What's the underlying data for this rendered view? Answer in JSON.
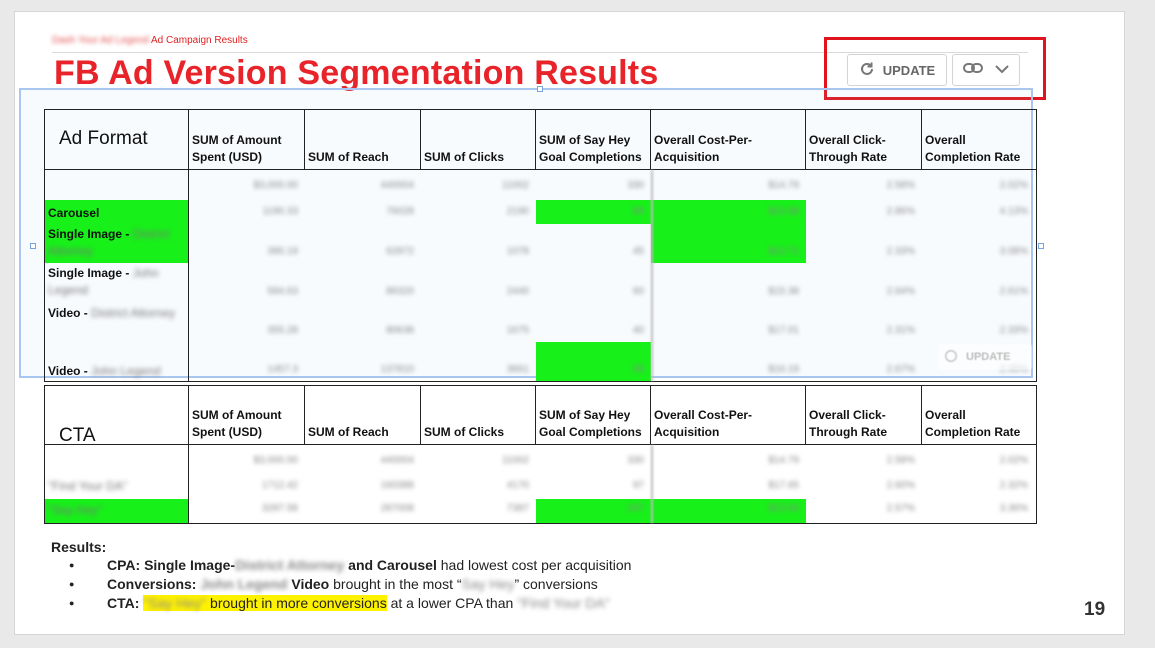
{
  "breadcrumb": {
    "blurred": "Dash Your Ad Legend",
    "label": "Ad Campaign Results"
  },
  "title": "FB Ad Version Segmentation Results",
  "toolbar": {
    "update_label": "UPDATE",
    "ghost_update_label": "UPDATE"
  },
  "columns": [
    "SUM of Amount Spent (USD)",
    "SUM of Reach",
    "SUM of Clicks",
    "SUM of Say Hey Goal Completions",
    "Overall Cost-Per-Acquisition",
    "Overall Click-Through Rate",
    "Overall Completion Rate"
  ],
  "table1": {
    "header": "Ad Format",
    "rows": [
      {
        "label": "",
        "blur": "",
        "values": [
          "$3,000.00",
          "440004",
          "11002",
          "330",
          "$14.79",
          "2.58%",
          "2.02%"
        ]
      },
      {
        "label": "Carousel",
        "blur": "",
        "values": [
          "1190.33",
          "76028",
          "2190",
          "89",
          "$13.38",
          "2.86%",
          "4.13%"
        ]
      },
      {
        "label": "Single Image - ",
        "blur": "District Attorney",
        "values": [
          "390.19",
          "62872",
          "1078",
          "45",
          "$12.71",
          "2.33%",
          "3.08%"
        ]
      },
      {
        "label": "Single Image - ",
        "blur": "John Legend",
        "values": [
          "584.63",
          "86320",
          "2440",
          "60",
          "$15.38",
          "2.64%",
          "2.61%"
        ]
      },
      {
        "label": "Video - ",
        "blur": "District Attorney",
        "values": [
          "355.28",
          "80638",
          "1675",
          "40",
          "$17.01",
          "2.31%",
          "2.33%"
        ]
      },
      {
        "label": "Video - ",
        "blur": "John Legend",
        "values": [
          "1457.3",
          "137810",
          "3661",
          "96",
          "$16.19",
          "2.67%",
          "2.45%"
        ]
      }
    ]
  },
  "table2": {
    "header": "CTA",
    "rows": [
      {
        "label": "",
        "blur": "",
        "values": [
          "$3,000.00",
          "440004",
          "11002",
          "330",
          "$14.79",
          "2.58%",
          "2.02%"
        ]
      },
      {
        "label": "",
        "blur": "\"Find Your DA\"",
        "values": [
          "1712.42",
          "160388",
          "4170",
          "97",
          "$17.65",
          "2.60%",
          "2.32%"
        ]
      },
      {
        "label": "",
        "blur": "\"Say Hey\"",
        "values": [
          "3287.58",
          "287008",
          "7387",
          "247",
          "$13.93",
          "2.57%",
          "3.36%"
        ]
      }
    ]
  },
  "results": {
    "heading": "Results:",
    "b1": {
      "a": "CPA: Single Image-",
      "blur": "District Attorney",
      "b": " and Carousel",
      "c": " had lowest cost per acquisition"
    },
    "b2": {
      "a": "Conversions: ",
      "blur": "John Legend",
      "b": " Video",
      "c": " brought in the most “",
      "blur2": "Say Hey",
      "d": "” conversions"
    },
    "b3": {
      "a": "CTA: ",
      "blur": "\"Say Hey\"",
      "hl": " brought in more conversions",
      "c": " at a lower CPA than ",
      "blur2": "\"Find Your DA\""
    }
  },
  "page_number": "19",
  "colors": {
    "title": "#e8232a",
    "highlight_green": "#17f019",
    "highlight_yellow": "#fff200",
    "annotation_red": "#e0141c"
  }
}
